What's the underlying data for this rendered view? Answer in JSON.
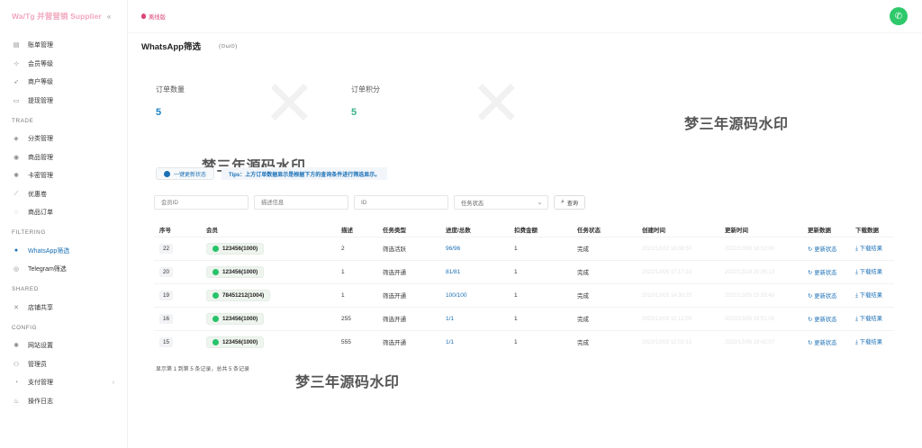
{
  "app": {
    "brand": "Wa/Tg 并营营销 Supplier",
    "collapse_icon": "double-chevron-left-icon"
  },
  "topbar": {
    "live_label": "离线版",
    "avatar": "whatsapp-icon"
  },
  "sidebar": {
    "items_top": [
      {
        "label": "账单管理",
        "icon": "bill-icon"
      },
      {
        "label": "会员等级",
        "icon": "network-icon"
      },
      {
        "label": "商户等级",
        "icon": "rocket-icon"
      },
      {
        "label": "提现管理",
        "icon": "card-icon"
      }
    ],
    "sections": [
      {
        "title": "TRADE",
        "items": [
          {
            "label": "分类管理",
            "icon": "tag-icon"
          },
          {
            "label": "商品管理",
            "icon": "shop-icon"
          },
          {
            "label": "卡密管理",
            "icon": "gear-icon"
          },
          {
            "label": "优惠卷",
            "icon": "coupon-icon"
          },
          {
            "label": "商品订单",
            "icon": "order-icon"
          }
        ]
      },
      {
        "title": "FILTERING",
        "items": [
          {
            "label": "WhatsApp筛选",
            "icon": "whatsapp-icon",
            "active": true
          },
          {
            "label": "Telegram筛选",
            "icon": "telegram-icon"
          }
        ]
      },
      {
        "title": "SHARED",
        "items": [
          {
            "label": "店铺共享",
            "icon": "share-icon"
          }
        ]
      },
      {
        "title": "CONFIG",
        "items": [
          {
            "label": "网站设置",
            "icon": "settings-icon"
          },
          {
            "label": "管理员",
            "icon": "admin-icon"
          },
          {
            "label": "支付管理",
            "icon": "payment-icon",
            "has_submenu": true
          },
          {
            "label": "操作日志",
            "icon": "log-icon"
          }
        ]
      }
    ]
  },
  "page": {
    "title": "WhatsApp筛选",
    "subtitle": "(⊙ω⊙)"
  },
  "stats": [
    {
      "label": "订单数量",
      "value": "5"
    },
    {
      "label": "订单积分",
      "value": "5"
    }
  ],
  "watermark": "梦三年源码水印",
  "actions": {
    "refresh_label": "一键更新状态",
    "tips": "Tips：上方订单数据显示是根据下方的查询条件进行筛选显示。"
  },
  "filters": {
    "member_placeholder": "会员ID",
    "desc_placeholder": "描述信息",
    "id_placeholder": "ID",
    "status_placeholder": "任务状态",
    "query_label": "查询"
  },
  "table": {
    "headers": [
      "序号",
      "会员",
      "描述",
      "任务类型",
      "进度/总数",
      "扣费金额",
      "任务状态",
      "创建时间",
      "更新时间",
      "更新数据",
      "下载数据"
    ],
    "rows": [
      {
        "seq": "22",
        "member": "123456(1000)",
        "desc": "2",
        "type": "筛选活跃",
        "progress": "96/96",
        "fee": "1",
        "status": "完成",
        "created": "2022/12/02 18:08:50",
        "updated": "2022/12/03 18:10:00",
        "update_action": "更新状态",
        "download_action": "下载结果"
      },
      {
        "seq": "20",
        "member": "123456(1000)",
        "desc": "1",
        "type": "筛选开通",
        "progress": "81/81",
        "fee": "1",
        "status": "完成",
        "created": "2022/12/05 17:17:19",
        "updated": "2022/12/14 20:36:13",
        "update_action": "更新状态",
        "download_action": "下载结果"
      },
      {
        "seq": "19",
        "member": "78451212(1004)",
        "desc": "1",
        "type": "筛选开通",
        "progress": "100/100",
        "fee": "1",
        "status": "完成",
        "created": "2022/12/05 14:30:25",
        "updated": "2022/12/05 15:55:48",
        "update_action": "更新状态",
        "download_action": "下载结果"
      },
      {
        "seq": "16",
        "member": "123456(1000)",
        "desc": "255",
        "type": "筛选开通",
        "progress": "1/1",
        "fee": "1",
        "status": "完成",
        "created": "2022/12/03 12:12:03",
        "updated": "2022/12/05 15:51:05",
        "update_action": "更新状态",
        "download_action": "下载结果"
      },
      {
        "seq": "15",
        "member": "123456(1000)",
        "desc": "555",
        "type": "筛选开通",
        "progress": "1/1",
        "fee": "1",
        "status": "完成",
        "created": "2022/12/03 12:02:13",
        "updated": "2022/12/05 19:42:07",
        "update_action": "更新状态",
        "download_action": "下载结果"
      }
    ]
  },
  "pagination_note": "显示第 1 到第 5 条记录，总共 5 条记录"
}
